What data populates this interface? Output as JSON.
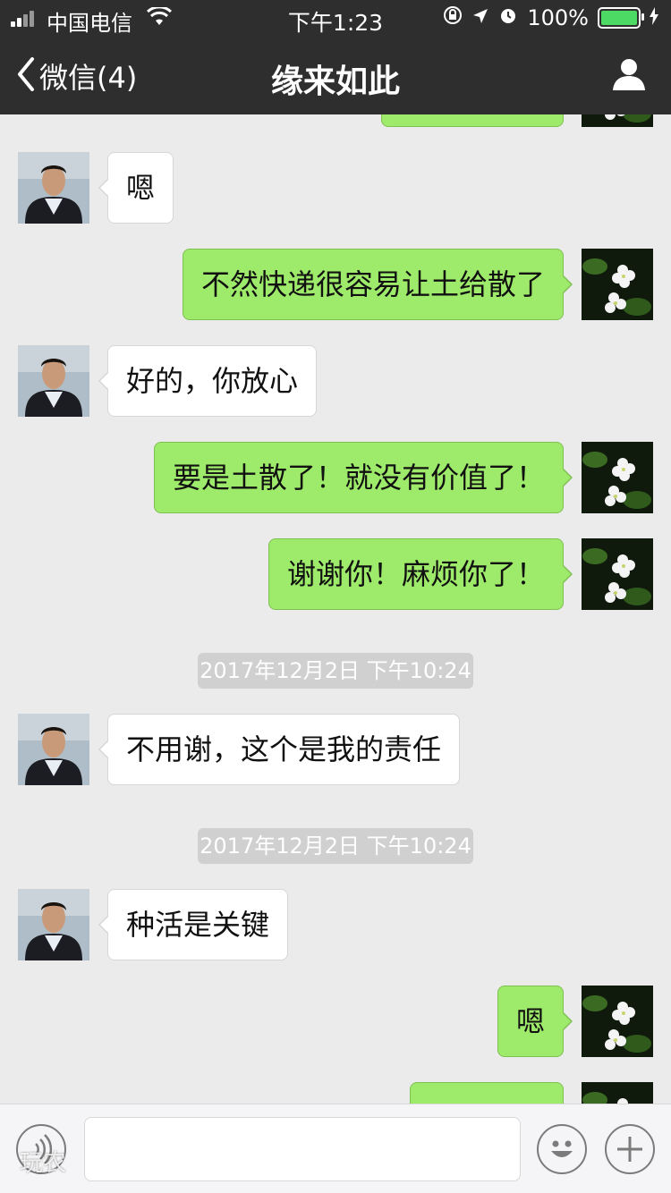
{
  "status_bar": {
    "carrier": "中国电信",
    "time": "下午1:23",
    "battery": "100%",
    "battery_level": 1.0
  },
  "nav": {
    "back_label": "微信(4)",
    "title": "缘来如此",
    "back_icon": "chevron-left-icon",
    "profile_icon": "person-icon"
  },
  "colors": {
    "nav_bg": "#2e2e2f",
    "chat_bg": "#ebebeb",
    "self_bubble": "#9eea6a",
    "other_bubble": "#ffffff"
  },
  "messages": [
    {
      "type": "self",
      "text": ""
    },
    {
      "type": "other",
      "text": "嗯"
    },
    {
      "type": "self",
      "text": "不然快递很容易让土给散了"
    },
    {
      "type": "other",
      "text": "好的，你放心"
    },
    {
      "type": "self",
      "text": "要是土散了！就没有价值了！"
    },
    {
      "type": "self",
      "text": "谢谢你！麻烦你了！"
    },
    {
      "type": "time",
      "text": "2017年12月2日 下午10:24"
    },
    {
      "type": "other",
      "text": "不用谢，这个是我的责任"
    },
    {
      "type": "time",
      "text": "2017年12月2日 下午10:24"
    },
    {
      "type": "other",
      "text": "种活是关键"
    },
    {
      "type": "self",
      "text": "嗯"
    },
    {
      "type": "self",
      "text": ""
    }
  ],
  "input_bar": {
    "voice_icon": "voice-icon",
    "emoji_icon": "emoji-icon",
    "plus_icon": "plus-icon",
    "input_value": ""
  },
  "watermark": "玩农"
}
